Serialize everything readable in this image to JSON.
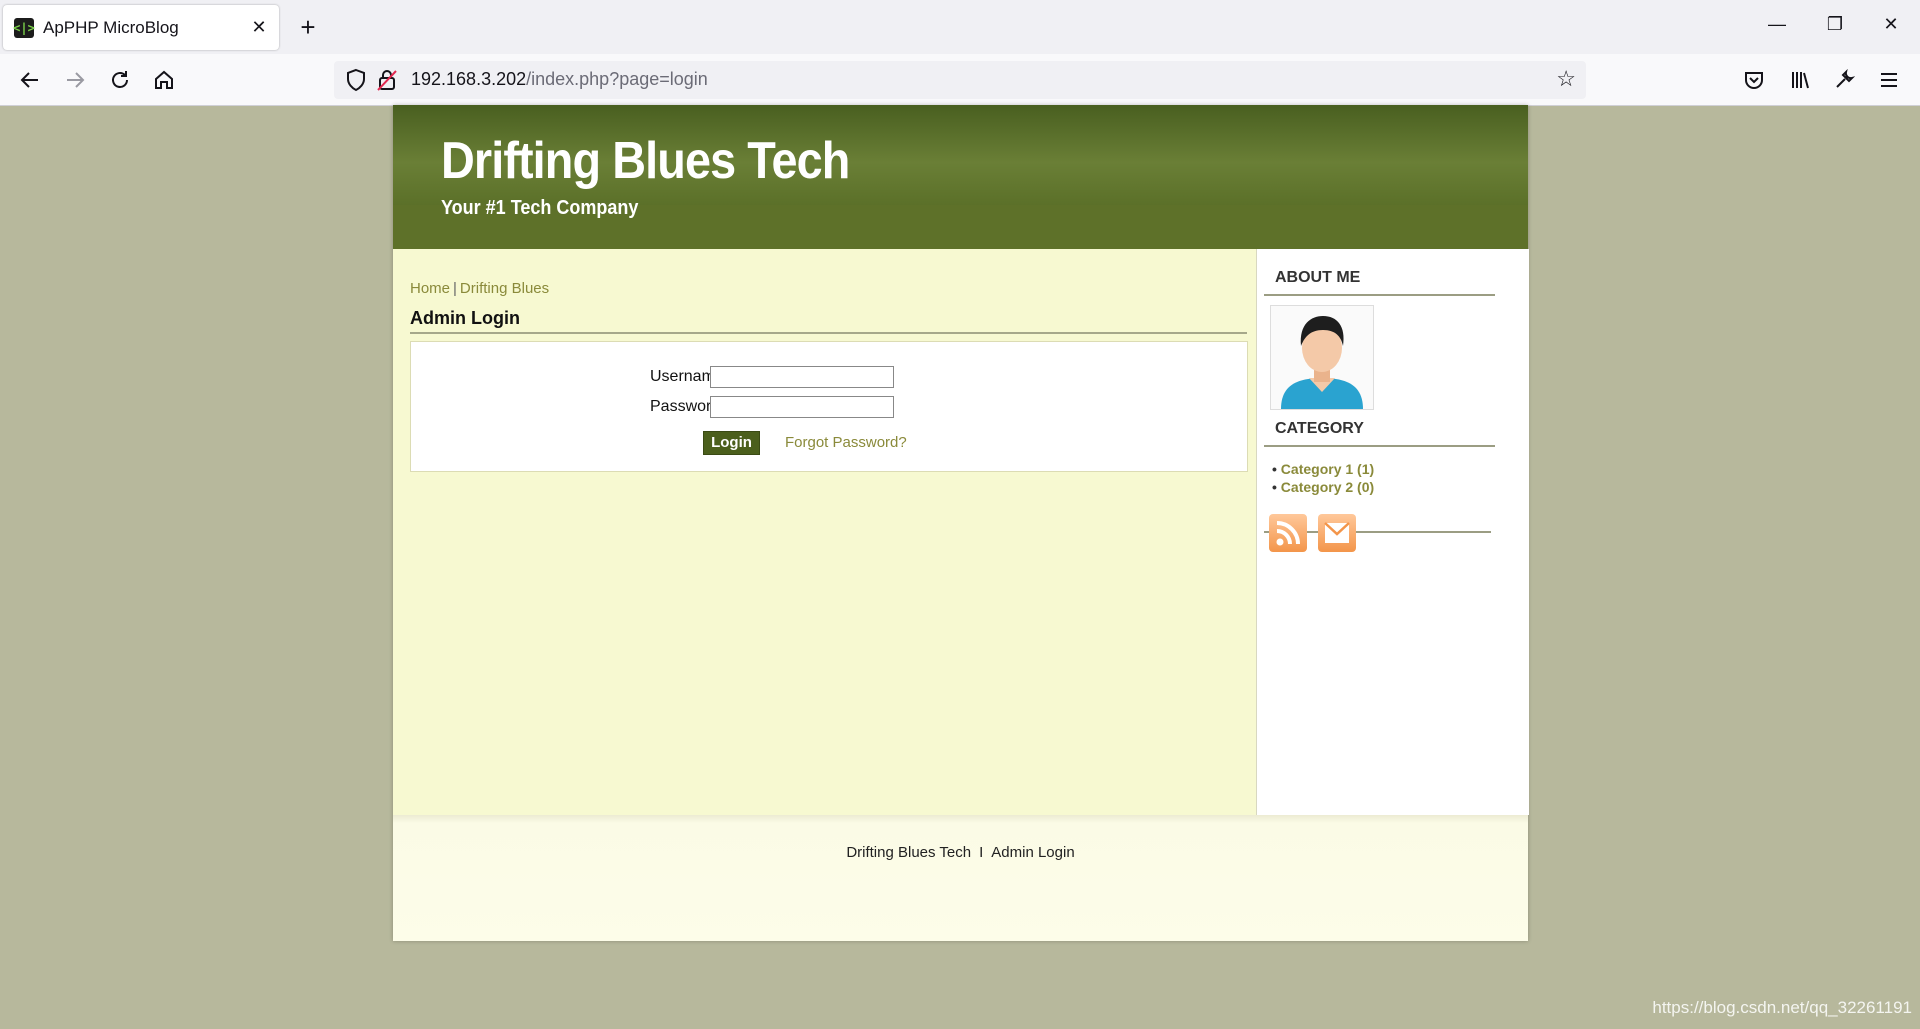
{
  "browser": {
    "tab_title": "ApPHP MicroBlog",
    "tab_favicon_text": "<|>",
    "url_host": "192.168.3.202",
    "url_path": "/index.php?page=login"
  },
  "site": {
    "title": "Drifting Blues Tech",
    "subtitle": "Your #1 Tech Company"
  },
  "breadcrumb": {
    "home": "Home",
    "separator": "|",
    "current": "Drifting Blues"
  },
  "login": {
    "title": "Admin Login",
    "username_label": "Username",
    "password_label": "Password",
    "username_value": "",
    "password_value": "",
    "login_button": "Login",
    "forgot_link": "Forgot Password?"
  },
  "sidebar": {
    "about_heading": "ABOUT ME",
    "category_heading": "CATEGORY",
    "categories": [
      {
        "bullet": "•",
        "label": "Category 1 (1)"
      },
      {
        "bullet": "•",
        "label": "Category 2 (0)"
      }
    ]
  },
  "footer": {
    "site_link": "Drifting Blues Tech",
    "separator": "I",
    "admin_link": "Admin Login"
  },
  "watermark": "https://blog.csdn.net/qq_32261191",
  "colors": {
    "header_green": "#5e7129",
    "content_bg": "#f7f9d1",
    "link_olive": "#8a8a3a",
    "button_green": "#4b5f1c",
    "page_bg": "#b7b89c"
  }
}
